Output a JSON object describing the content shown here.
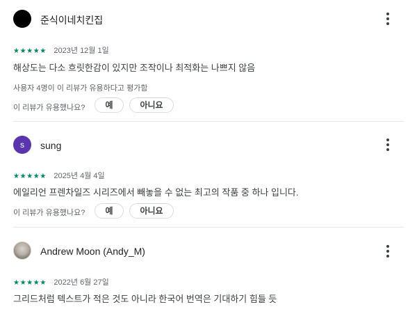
{
  "reviews": [
    {
      "author": "준식이네치킨집",
      "avatar_letter": "",
      "stars": 5,
      "star_glyph": "★",
      "date": "2023년 12월 1일",
      "text": "해상도는 다소 흐릿한감이 있지만 조작이나 최적화는 나쁘지 않음",
      "helpful_count_text": "사용자 4명이 이 리뷰가 유용하다고 평가함",
      "helpful_question": "이 리뷰가 유용했나요?",
      "yes_label": "예",
      "no_label": "아니요"
    },
    {
      "author": "sung",
      "avatar_letter": "s",
      "avatar_color": "#5b35b0",
      "stars": 5,
      "star_glyph": "★",
      "date": "2025년 4월 4일",
      "text": "에일리언 프렌차일즈 시리즈에서 빼놓을 수 없는 최고의 작품 중 하나 입니다.",
      "helpful_question": "이 리뷰가 유용했나요?",
      "yes_label": "예",
      "no_label": "아니요"
    },
    {
      "author": "Andrew Moon (Andy_M)",
      "avatar_letter": "",
      "stars": 5,
      "star_glyph": "★",
      "date": "2022년 6월 27일",
      "text": "그리드처럼 텍스트가 적은 것도 아니라 한국어 번역은 기대하기 힘들 듯"
    }
  ],
  "colors": {
    "star": "#01875f",
    "accent_avatar": "#5b35b0"
  }
}
